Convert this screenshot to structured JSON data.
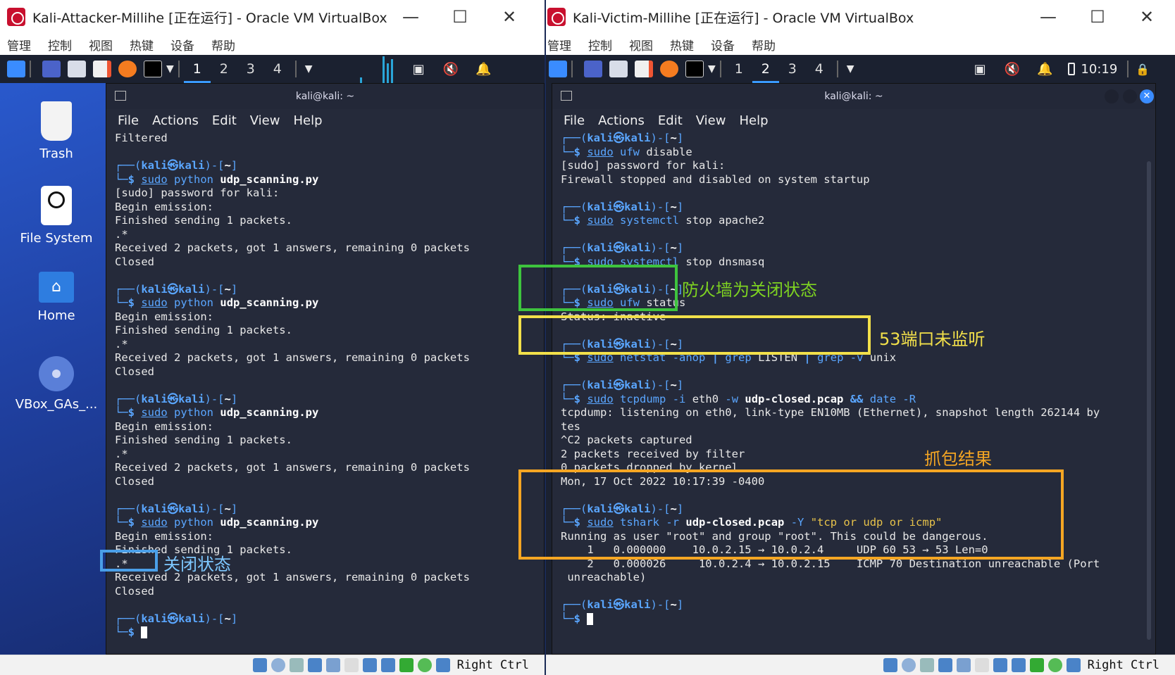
{
  "left_vm": {
    "title": "Kali-Attacker-Millihe [正在运行] - Oracle VM VirtualBox",
    "menu": [
      "管理",
      "控制",
      "视图",
      "热键",
      "设备",
      "帮助"
    ],
    "workspaces": [
      "1",
      "2",
      "3",
      "4"
    ],
    "active_workspace": "1",
    "desktop_icons": [
      "Trash",
      "File System",
      "Home",
      "VBox_GAs_..."
    ],
    "terminal": {
      "title": "kali@kali: ~",
      "menu": [
        "File",
        "Actions",
        "Edit",
        "View",
        "Help"
      ],
      "prompt_user": "kali",
      "prompt_host": "kali",
      "prompt_dir": "~",
      "lines": {
        "filtered": "Filtered",
        "sudo_pw": "[sudo] password for kali:",
        "begin": "Begin emission:",
        "finished": "Finished sending 1 packets.",
        "dot": ".*",
        "received": "Received 2 packets, got 1 answers, remaining 0 packets",
        "closed": "Closed"
      },
      "cmd_sudo": "sudo",
      "cmd_python": "python",
      "cmd_script": "udp_scanning.py"
    },
    "annotation": "关闭状态",
    "statusbar_text": "Right Ctrl"
  },
  "right_vm": {
    "title": "Kali-Victim-Millihe [正在运行] - Oracle VM VirtualBox",
    "menu": [
      "管理",
      "控制",
      "视图",
      "热键",
      "设备",
      "帮助"
    ],
    "workspaces": [
      "1",
      "2",
      "3",
      "4"
    ],
    "active_workspace": "2",
    "clock": "10:19",
    "terminal": {
      "title": "kali@kali: ~",
      "menu": [
        "File",
        "Actions",
        "Edit",
        "View",
        "Help"
      ],
      "c1": {
        "a": "ufw",
        "b": "disable"
      },
      "c1_out1": "[sudo] password for kali:",
      "c1_out2": "Firewall stopped and disabled on system startup",
      "c2": {
        "a": "systemctl",
        "b": "stop apache2"
      },
      "c3": {
        "a": "systemctl",
        "b": "stop dnsmasq"
      },
      "c4": {
        "a": "ufw",
        "b": "status"
      },
      "c4_out": "Status: inactive",
      "c5": {
        "a": "netstat",
        "b": "-anop",
        "pipe": "|",
        "g1": "grep",
        "g1a": "LISTEN",
        "g2": "grep",
        "g2a": "-v",
        "g2b": "unix"
      },
      "c6": {
        "a": "tcpdump",
        "b": "-i",
        "c": "eth0",
        "d": "-w",
        "file": "udp-closed.pcap",
        "and": "&&",
        "date": "date",
        "r": "-R"
      },
      "c6_out1": "tcpdump: listening on eth0, link-type EN10MB (Ethernet), snapshot length 262144 by",
      "c6_out2": "tes",
      "c6_out3": "^C2 packets captured",
      "c6_out4": "2 packets received by filter",
      "c6_out5": "0 packets dropped by kernel",
      "c6_out6": "Mon, 17 Oct 2022 10:17:39 -0400",
      "c7": {
        "a": "tshark",
        "b": "-r",
        "file": "udp-closed.pcap",
        "y": "-Y",
        "filter": "\"tcp or udp or icmp\""
      },
      "c7_out1": "Running as user \"root\" and group \"root\". This could be dangerous.",
      "c7_out2": "    1   0.000000    10.0.2.15 → 10.0.2.4     UDP 60 53 → 53 Len=0",
      "c7_out3": "    2   0.000026     10.0.2.4 → 10.0.2.15    ICMP 70 Destination unreachable (Port",
      "c7_out4": " unreachable)"
    },
    "annotations": {
      "firewall": "防火墙为关闭状态",
      "port": "53端口未监听",
      "capture": "抓包结果"
    },
    "statusbar_text": "Right Ctrl"
  },
  "colors": {
    "green_box": "#3ec43e",
    "yellow_box": "#f2e04a",
    "orange_box": "#f5a623",
    "blue_box": "#4a9fe8",
    "green_text": "#7ed321",
    "yellow_text": "#f2e04a",
    "orange_text": "#f5a623",
    "blue_text": "#7ec8ff"
  }
}
